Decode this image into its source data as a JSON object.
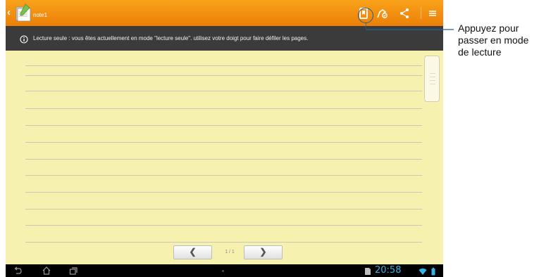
{
  "app": {
    "note_title": "note1"
  },
  "toolbar": {
    "icons": [
      "back-chevron-icon",
      "notebook-app-icon",
      "reading-mode-bookmark-icon",
      "draw-mode-icon",
      "share-icon",
      "menu-icon"
    ]
  },
  "info": {
    "icon": "info-icon",
    "text": "Lecture seule : vous êtes actuellement en mode \"lecture seule\". utilisez votre doigt pour faire défiler les pages."
  },
  "pagination": {
    "prev": "❮",
    "next": "❯",
    "indicator": "1 / 1"
  },
  "system_bar": {
    "clock": "20:58",
    "icons": [
      "back-icon",
      "home-icon",
      "recent-apps-icon",
      "file-icon",
      "wifi-icon",
      "battery-icon"
    ]
  },
  "callout": {
    "lines": [
      "Appuyez pour",
      "passer en mode",
      "de lecture"
    ]
  },
  "colors": {
    "toolbar": "#f39414",
    "info_bar": "#3b3b3b",
    "paper": "#f7f1b0",
    "clock": "#36b3e6",
    "callout": "#1f5f98"
  }
}
